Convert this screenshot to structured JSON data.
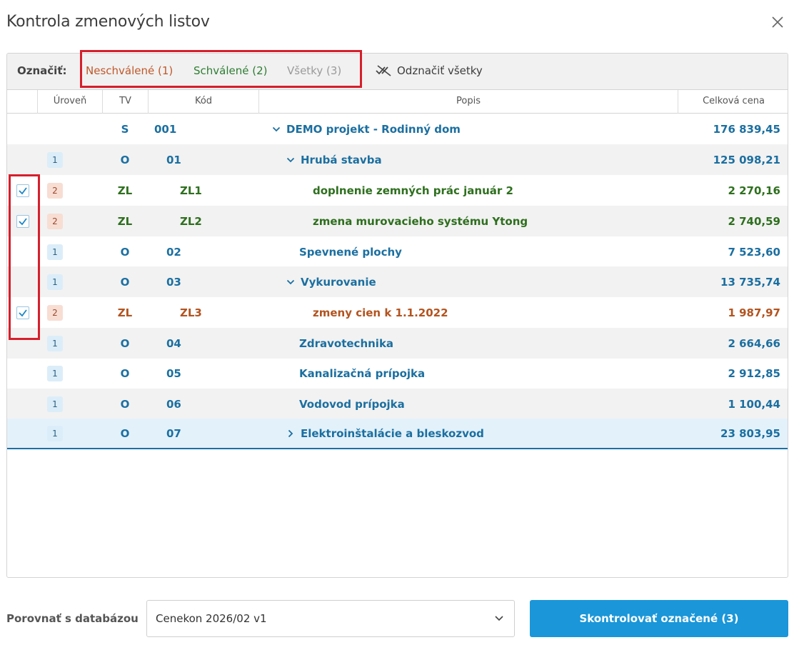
{
  "dialog": {
    "title": "Kontrola zmenových listov",
    "close_icon": "close-icon"
  },
  "toolbar": {
    "label": "Označiť:",
    "filters": {
      "unapproved": "Neschválené (1)",
      "approved": "Schválené (2)",
      "all": "Všetky (3)"
    },
    "clear_label": "Odznačiť všetky",
    "clear_icon": "unselect-icon"
  },
  "table": {
    "columns": {
      "level": "Úroveň",
      "tv": "TV",
      "code": "Kód",
      "description": "Popis",
      "total_price": "Celková cena"
    },
    "rows": [
      {
        "checked": false,
        "level": "",
        "tv": "S",
        "code": "001",
        "desc": "DEMO projekt - Rodinný dom",
        "price": "176 839,45",
        "chevron": "down",
        "color": "blue",
        "indent": 0
      },
      {
        "checked": false,
        "level": "1",
        "tv": "O",
        "code": "01",
        "desc": "Hrubá stavba",
        "price": "125 098,21",
        "chevron": "down",
        "color": "blue",
        "indent": 1
      },
      {
        "checked": true,
        "level": "2",
        "tv": "ZL",
        "code": "ZL1",
        "desc": "doplnenie zemných prác január 2",
        "price": "2 270,16",
        "chevron": "",
        "color": "green",
        "indent": 2
      },
      {
        "checked": true,
        "level": "2",
        "tv": "ZL",
        "code": "ZL2",
        "desc": "zmena murovacieho systému Ytong",
        "price": "2 740,59",
        "chevron": "",
        "color": "green",
        "indent": 2
      },
      {
        "checked": false,
        "level": "1",
        "tv": "O",
        "code": "02",
        "desc": "Spevnené plochy",
        "price": "7 523,60",
        "chevron": "",
        "color": "blue",
        "indent": 1
      },
      {
        "checked": false,
        "level": "1",
        "tv": "O",
        "code": "03",
        "desc": "Vykurovanie",
        "price": "13 735,74",
        "chevron": "down",
        "color": "blue",
        "indent": 1
      },
      {
        "checked": true,
        "level": "2",
        "tv": "ZL",
        "code": "ZL3",
        "desc": "zmeny cien k 1.1.2022",
        "price": "1 987,97",
        "chevron": "",
        "color": "orange",
        "indent": 2
      },
      {
        "checked": false,
        "level": "1",
        "tv": "O",
        "code": "04",
        "desc": "Zdravotechnika",
        "price": "2 664,66",
        "chevron": "",
        "color": "blue",
        "indent": 1
      },
      {
        "checked": false,
        "level": "1",
        "tv": "O",
        "code": "05",
        "desc": "Kanalizačná prípojka",
        "price": "2 912,85",
        "chevron": "",
        "color": "blue",
        "indent": 1
      },
      {
        "checked": false,
        "level": "1",
        "tv": "O",
        "code": "06",
        "desc": "Vodovod prípojka",
        "price": "1 100,44",
        "chevron": "",
        "color": "blue",
        "indent": 1
      },
      {
        "checked": false,
        "level": "1",
        "tv": "O",
        "code": "07",
        "desc": "Elektroinštalácie a bleskozvod",
        "price": "23 803,95",
        "chevron": "right",
        "color": "blue",
        "indent": 1
      }
    ]
  },
  "footer": {
    "compare_label": "Porovnať s databázou",
    "database_value": "Cenekon 2026/02 v1",
    "submit_label": "Skontrolovať označené (3)"
  },
  "colors": {
    "accent": "#1a96d9",
    "blue_text": "#1b6fa0",
    "green_text": "#2e6f1e",
    "orange_text": "#b3531f",
    "highlight_red": "#d61f2c"
  }
}
